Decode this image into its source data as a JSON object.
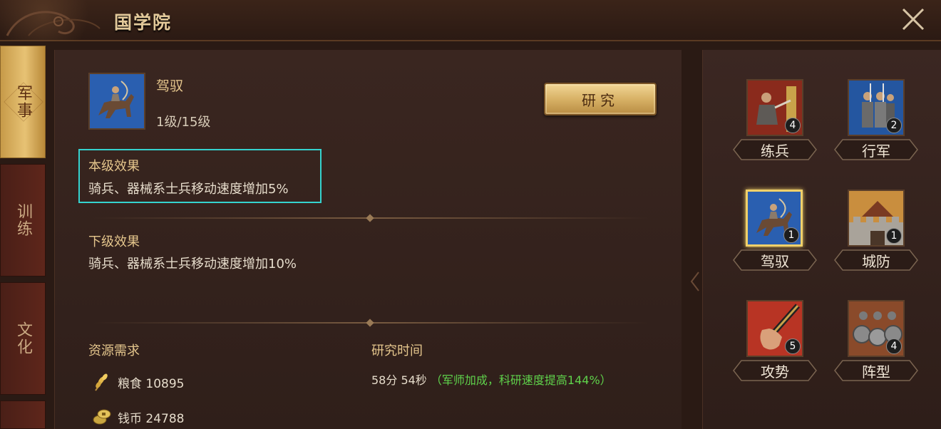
{
  "header": {
    "title": "国学院"
  },
  "tabs": [
    {
      "label": "军事",
      "active": true
    },
    {
      "label": "训练",
      "active": false
    },
    {
      "label": "文化",
      "active": false
    }
  ],
  "skill": {
    "name": "驾驭",
    "level": "1级/15级"
  },
  "research_button": "研究",
  "current_effect": {
    "title": "本级效果",
    "text": "骑兵、器械系士兵移动速度增加5%"
  },
  "next_effect": {
    "title": "下级效果",
    "text": "骑兵、器械系士兵移动速度增加10%"
  },
  "resources": {
    "title": "资源需求",
    "items": [
      {
        "name": "粮食",
        "amount": "10895",
        "icon": "grain-icon"
      },
      {
        "name": "钱币",
        "amount": "24788",
        "icon": "coin-icon"
      }
    ]
  },
  "research_time": {
    "title": "研究时间",
    "value": "58分 54秒",
    "bonus": "（军师加成，科研速度提高144%）"
  },
  "skill_grid": [
    {
      "label": "练兵",
      "count": "4",
      "selected": false
    },
    {
      "label": "行军",
      "count": "2",
      "selected": false
    },
    {
      "label": "驾驭",
      "count": "1",
      "selected": true
    },
    {
      "label": "城防",
      "count": "1",
      "selected": false
    },
    {
      "label": "攻势",
      "count": "5",
      "selected": false
    },
    {
      "label": "阵型",
      "count": "4",
      "selected": false
    }
  ],
  "colors": {
    "accent": "#e4c58c",
    "highlight": "#35d3cf",
    "bonus": "#5fd24b"
  }
}
